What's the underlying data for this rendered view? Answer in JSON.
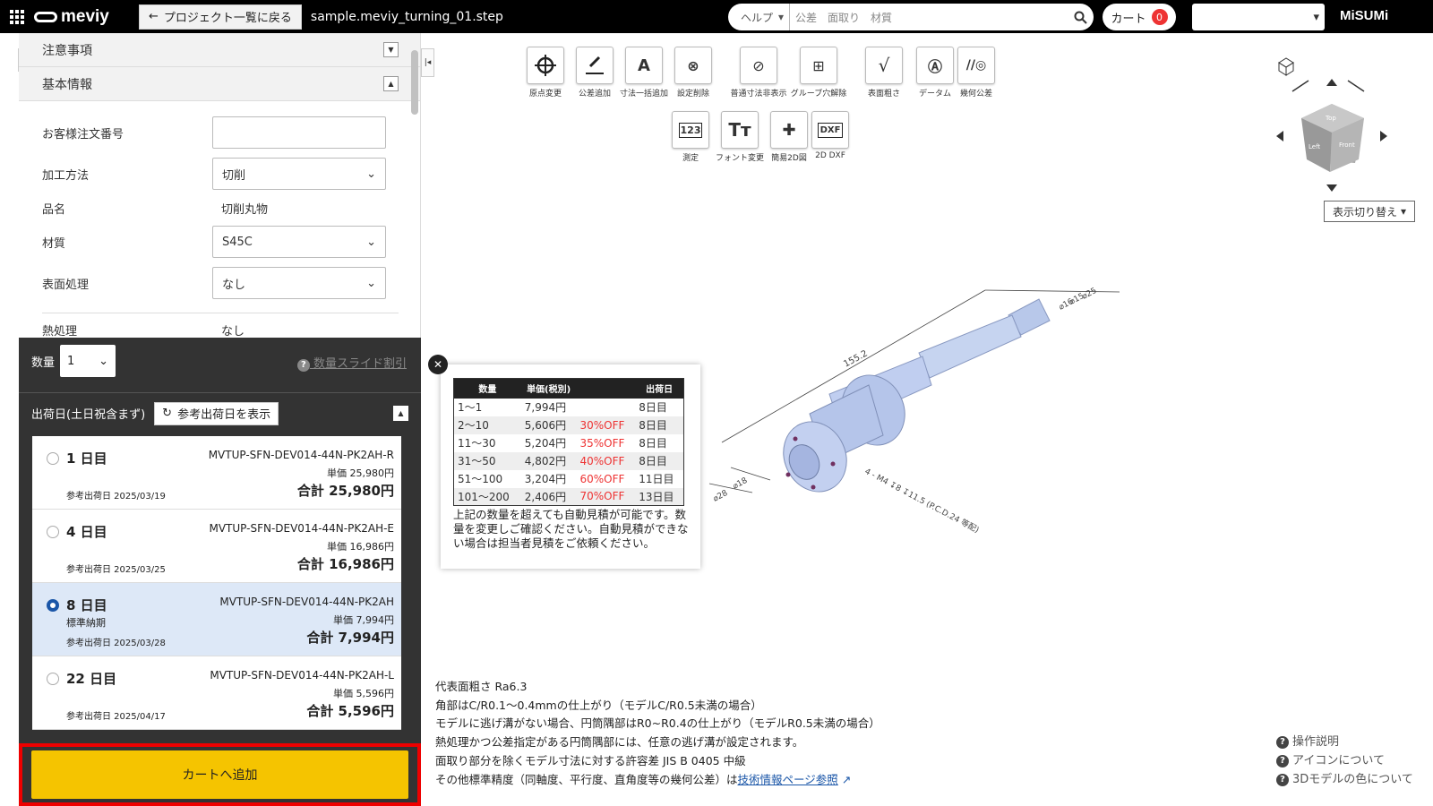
{
  "header": {
    "logo": "meviy",
    "back_label": "プロジェクト一覧に戻る",
    "filename": "sample.meviy_turning_01.step",
    "search_select": "ヘルプ",
    "search_placeholder": "公差　面取り　材質",
    "cart_label": "カート",
    "cart_count": "0",
    "brand": "MiSUMi"
  },
  "sidebar": {
    "section_notice": "注意事項",
    "section_basic": "基本情報",
    "fields": [
      {
        "label": "お客様注文番号",
        "value": ""
      },
      {
        "label": "加工方法",
        "value": "切削"
      },
      {
        "label": "品名",
        "value": "切削丸物"
      },
      {
        "label": "材質",
        "value": "S45C"
      },
      {
        "label": "表面処理",
        "value": "なし"
      },
      {
        "label": "熱処理",
        "value": "なし"
      }
    ]
  },
  "order": {
    "qty_label": "数量",
    "qty_value": "1",
    "slide_discount": "数量スライド割引",
    "ship_label": "出荷日(土日祝含まず)",
    "ref_button": "参考出荷日を表示",
    "options": [
      {
        "day": "1 日目",
        "code": "MVTUP-SFN-DEV014-44N-PK2AH-R",
        "unit": "単価 25,980円",
        "total": "合計 25,980円",
        "ref": "参考出荷日 2025/03/19",
        "std": ""
      },
      {
        "day": "4 日目",
        "code": "MVTUP-SFN-DEV014-44N-PK2AH-E",
        "unit": "単価 16,986円",
        "total": "合計 16,986円",
        "ref": "参考出荷日 2025/03/25",
        "std": ""
      },
      {
        "day": "8 日目",
        "code": "MVTUP-SFN-DEV014-44N-PK2AH",
        "unit": "単価 7,994円",
        "total": "合計 7,994円",
        "ref": "参考出荷日 2025/03/28",
        "std": "標準納期"
      },
      {
        "day": "22 日目",
        "code": "MVTUP-SFN-DEV014-44N-PK2AH-L",
        "unit": "単価 5,596円",
        "total": "合計 5,596円",
        "ref": "参考出荷日 2025/04/17",
        "std": ""
      }
    ],
    "add_to_cart": "カートへ追加"
  },
  "toolbar": {
    "row1": [
      "原点変更",
      "公差追加",
      "寸法一括追加",
      "設定削除",
      "普通寸法非表示",
      "グルーブ穴解除",
      "表面粗さ",
      "データム",
      "幾何公差"
    ],
    "row2": [
      "測定",
      "フォント変更",
      "簡易2D図",
      "2D DXF"
    ]
  },
  "view": {
    "switch_label": "表示切り替え"
  },
  "model": {
    "dim_length": "155.2",
    "dim_hole": "4 - M4 ↧8 ↧11.5 (P.C.D.24 等配)",
    "dim_d1": "⌀28",
    "dim_d2": "⌀18",
    "dim_d3": "⌀16",
    "dim_d4": "⌀25",
    "dim_d5": "⌀15"
  },
  "price_table": {
    "headers": [
      "数量",
      "単価(税別)",
      "",
      "出荷日"
    ],
    "rows": [
      [
        "1〜1",
        "7,994円",
        "",
        "8日目"
      ],
      [
        "2〜10",
        "5,606円",
        "30%OFF",
        "8日目"
      ],
      [
        "11〜30",
        "5,204円",
        "35%OFF",
        "8日目"
      ],
      [
        "31〜50",
        "4,802円",
        "40%OFF",
        "8日目"
      ],
      [
        "51〜100",
        "3,204円",
        "60%OFF",
        "11日目"
      ],
      [
        "101〜200",
        "2,406円",
        "70%OFF",
        "13日目"
      ]
    ],
    "note": "上記の数量を超えても自動見積が可能です。数量を変更しご確認ください。自動見積ができない場合は担当者見積をご依頼ください。"
  },
  "notes": {
    "lines": [
      "代表面粗さ Ra6.3",
      "角部はC/R0.1〜0.4mmの仕上がり（モデルC/R0.5未満の場合）",
      "モデルに逃げ溝がない場合、円筒隅部はR0~R0.4の仕上がり（モデルR0.5未満の場合）",
      "熱処理かつ公差指定がある円筒隅部には、任意の逃げ溝が設定されます。",
      "面取り部分を除くモデル寸法に対する許容差 JIS B 0405 中級"
    ],
    "last_prefix": "その他標準精度（同軸度、平行度、直角度等の幾何公差）は",
    "last_link": "技術情報ページ参照"
  },
  "help": {
    "links": [
      "操作説明",
      "アイコンについて",
      "3Dモデルの色について"
    ]
  }
}
